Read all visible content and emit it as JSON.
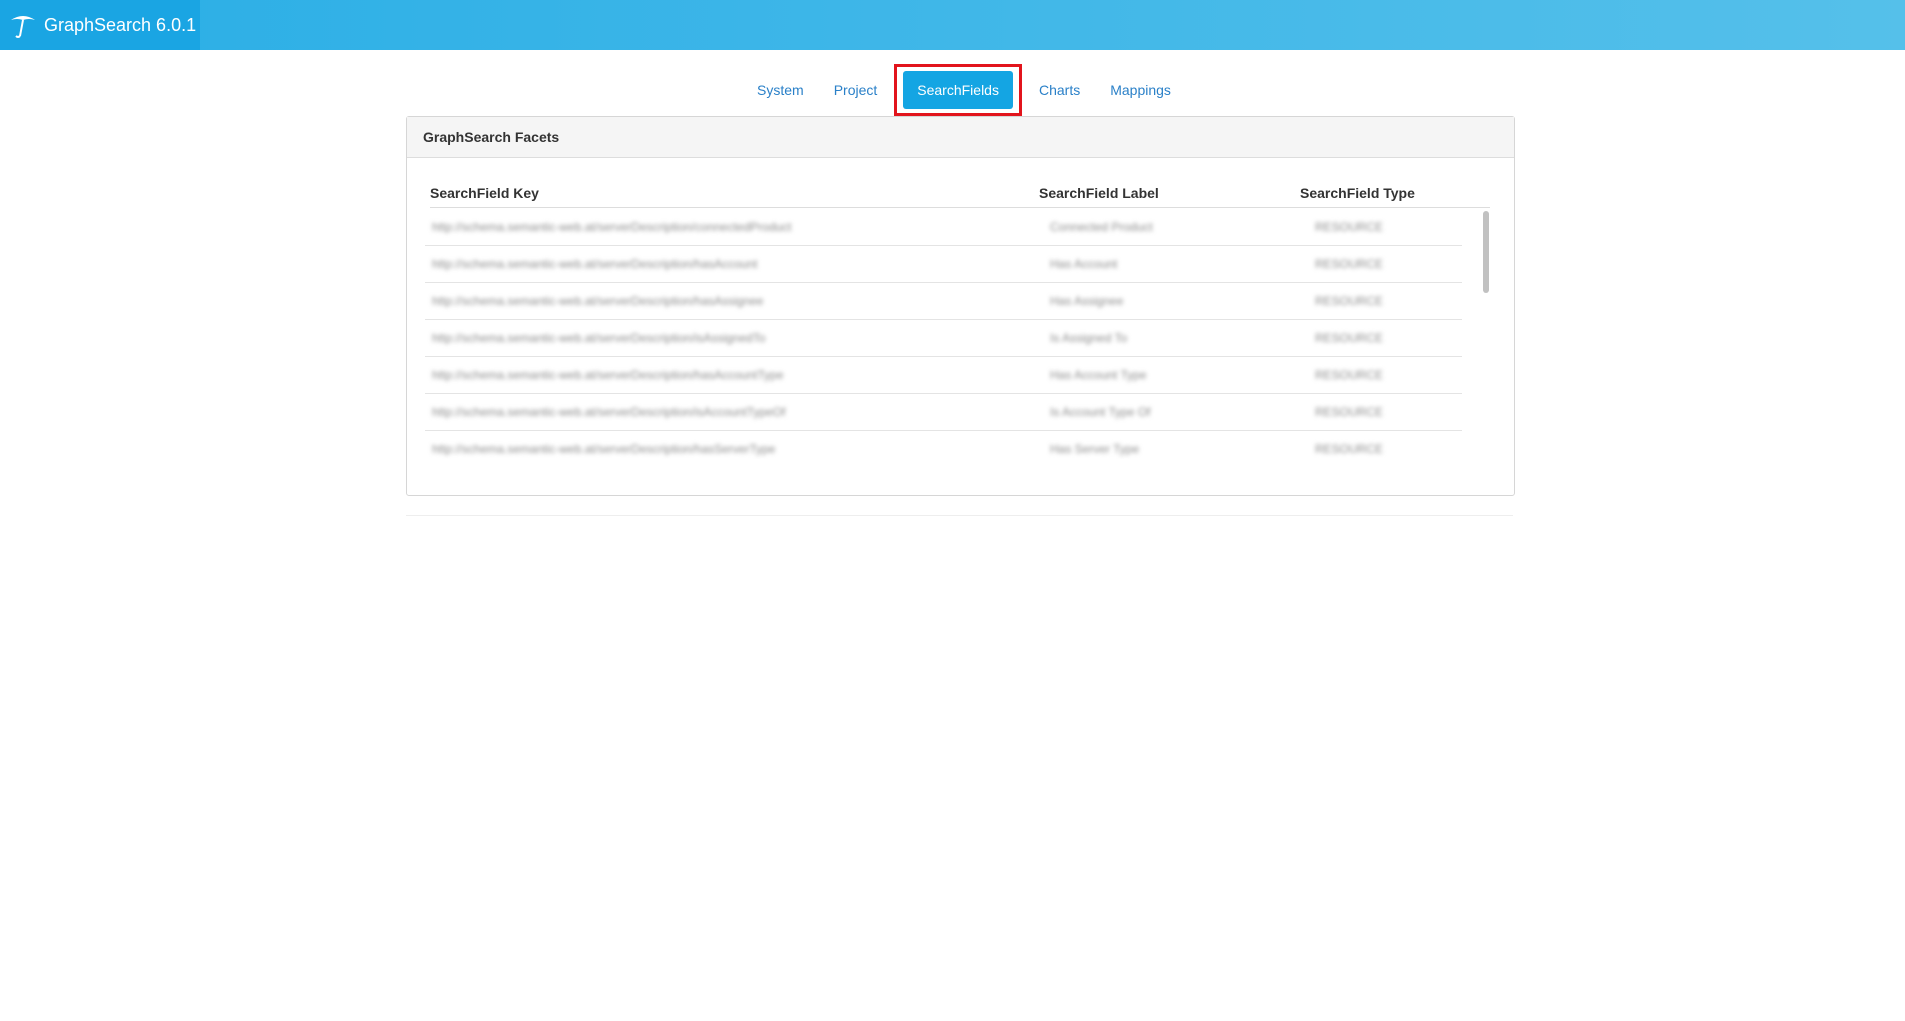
{
  "header": {
    "app_title": "GraphSearch 6.0.1"
  },
  "tabs": [
    {
      "label": "System"
    },
    {
      "label": "Project"
    },
    {
      "label": "SearchFields",
      "active": true
    },
    {
      "label": "Charts"
    },
    {
      "label": "Mappings"
    }
  ],
  "panel": {
    "title": "GraphSearch Facets",
    "columns": {
      "key": "SearchField Key",
      "label": "SearchField Label",
      "type": "SearchField Type"
    },
    "rows": [
      {
        "key": "http://schema.semantic-web.at/serverDescription/connectedProduct",
        "label": "Connected Product",
        "type": "RESOURCE"
      },
      {
        "key": "http://schema.semantic-web.at/serverDescription/hasAccount",
        "label": "Has Account",
        "type": "RESOURCE"
      },
      {
        "key": "http://schema.semantic-web.at/serverDescription/hasAssignee",
        "label": "Has Assignee",
        "type": "RESOURCE"
      },
      {
        "key": "http://schema.semantic-web.at/serverDescription/isAssignedTo",
        "label": "Is Assigned To",
        "type": "RESOURCE"
      },
      {
        "key": "http://schema.semantic-web.at/serverDescription/hasAccountType",
        "label": "Has Account Type",
        "type": "RESOURCE"
      },
      {
        "key": "http://schema.semantic-web.at/serverDescription/isAccountTypeOf",
        "label": "Is Account Type Of",
        "type": "RESOURCE"
      },
      {
        "key": "http://schema.semantic-web.at/serverDescription/hasServerType",
        "label": "Has Server Type",
        "type": "RESOURCE"
      }
    ]
  },
  "colors": {
    "header_gradient_start": "#2aaee6",
    "header_gradient_end": "#55c0ea",
    "active_tab": "#14a5e3",
    "highlight_border": "#e2141c",
    "link": "#2a80c8"
  },
  "icons": {
    "brand": "umbrella-icon"
  }
}
